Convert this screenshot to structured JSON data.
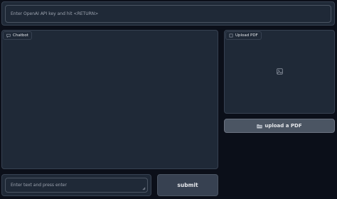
{
  "api_key_input": {
    "placeholder": "Enter OpenAI API key and hit <RETURN>"
  },
  "chatbot": {
    "label": "Chatbot",
    "icon": "chat-icon"
  },
  "upload_pdf": {
    "label": "Upload PDF",
    "icon": "file-icon",
    "placeholder_icon": "image-icon"
  },
  "upload_button": {
    "label": "upload a PDF",
    "icon": "folder-icon"
  },
  "message_input": {
    "placeholder": "Enter text and press enter"
  },
  "submit_button": {
    "label": "submit"
  }
}
